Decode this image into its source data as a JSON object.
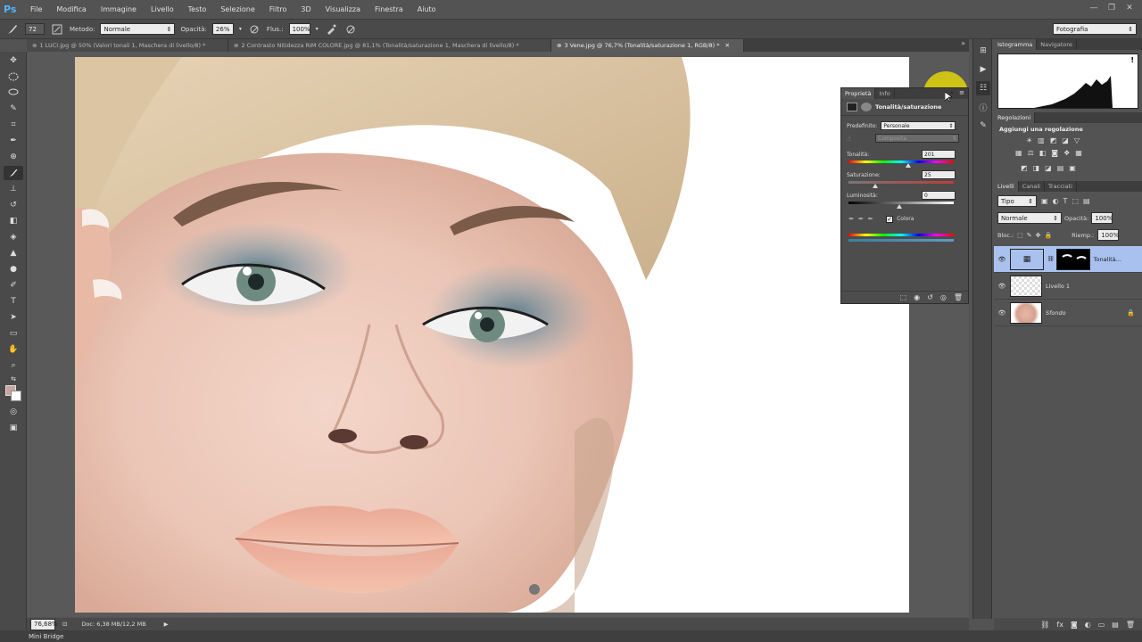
{
  "app": {
    "logo": "Ps"
  },
  "menu": [
    "File",
    "Modifica",
    "Immagine",
    "Livello",
    "Testo",
    "Selezione",
    "Filtro",
    "3D",
    "Visualizza",
    "Finestra",
    "Aiuto"
  ],
  "window_controls": {
    "minimize": "—",
    "restore": "❐",
    "close": "✕"
  },
  "options": {
    "brush_size": "72",
    "metodo_label": "Metodo:",
    "metodo_value": "Normale",
    "opacita_label": "Opacità:",
    "opacita_value": "26%",
    "flusso_label": "Flus.:",
    "flusso_value": "100%",
    "workspace": "Fotografia"
  },
  "doc_tabs": [
    {
      "label": "1 LUCI.jpg @ 50% (Valori tonali 1, Maschera di livello/8) *"
    },
    {
      "label": "2 Contrasto Nitidezza RIM COLORE.jpg @ 81,1% (Tonalità/saturazione 1, Maschera di livello/8) *"
    },
    {
      "label": "3 Vene.jpg @ 76,7% (Tonalità/saturazione 1, RGB/8) *"
    }
  ],
  "status": {
    "zoom": "76,68%",
    "doc": "Doc: 6,38 MB/12,2 MB"
  },
  "bottom": {
    "mini_bridge": "Mini Bridge"
  },
  "histogram": {
    "tab1": "Istogramma",
    "tab2": "Navigatore",
    "warning": "!"
  },
  "adjustments": {
    "tab": "Regolazioni",
    "heading": "Aggiungi una regolazione"
  },
  "layers": {
    "tab1": "Livelli",
    "tab2": "Canali",
    "tab3": "Tracciati",
    "filter": "Tipo",
    "blend": "Normale",
    "opacita_label": "Opacità:",
    "opacita_value": "100%",
    "blocca_label": "Bloc.:",
    "riemp_label": "Riemp.:",
    "riemp_value": "100%",
    "items": [
      {
        "name": "Tonalità..."
      },
      {
        "name": "Livello 1"
      },
      {
        "name": "Sfondo"
      }
    ]
  },
  "properties": {
    "tab1": "Proprietà",
    "tab2": "Info",
    "title": "Tonalità/saturazione",
    "predefinito_label": "Predefinito:",
    "predefinito_value": "Personale",
    "channel_value": "Composita",
    "tonalita_label": "Tonalità:",
    "tonalita_value": "201",
    "saturazione_label": "Saturazione:",
    "saturazione_value": "25",
    "luminosita_label": "Luminosità:",
    "luminosita_value": "0",
    "colora_label": "Colora",
    "colora_checked": "✓"
  },
  "colors": {
    "accent": "#a9c1ef",
    "panel": "#535353",
    "highlight": "#f5e600"
  }
}
